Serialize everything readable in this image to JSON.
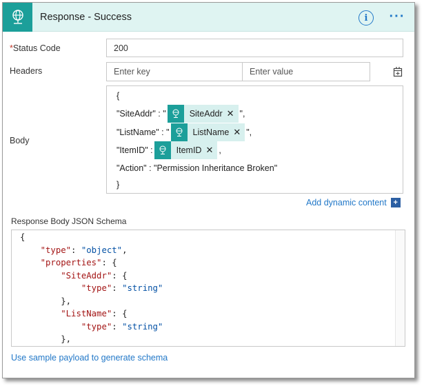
{
  "header": {
    "title": "Response - Success",
    "info_label": "i",
    "more_label": "···"
  },
  "form": {
    "status_code": {
      "required_mark": "*",
      "label": "Status Code",
      "value": "200"
    },
    "headers": {
      "label": "Headers",
      "key_placeholder": "Enter key",
      "value_placeholder": "Enter value"
    },
    "body": {
      "label": "Body",
      "open_brace": "{",
      "close_brace": "}",
      "lines": [
        {
          "prefix": "\"SiteAddr\" : \"",
          "token": "SiteAddr",
          "suffix": "\","
        },
        {
          "prefix": "\"ListName\" : \"",
          "token": "ListName",
          "suffix": "\","
        },
        {
          "prefix": "\"ItemID\" : ",
          "token": "ItemID",
          "suffix": ","
        }
      ],
      "action_line": "\"Action\" : \"Permission Inheritance Broken\""
    },
    "add_dynamic": "Add dynamic content",
    "schema": {
      "label": "Response Body JSON Schema",
      "lines": [
        {
          "indent": "",
          "parts": [
            {
              "t": "p",
              "v": "{"
            }
          ]
        },
        {
          "indent": "    ",
          "parts": [
            {
              "t": "k",
              "v": "\"type\""
            },
            {
              "t": "p",
              "v": ": "
            },
            {
              "t": "s",
              "v": "\"object\""
            },
            {
              "t": "p",
              "v": ","
            }
          ]
        },
        {
          "indent": "    ",
          "parts": [
            {
              "t": "k",
              "v": "\"properties\""
            },
            {
              "t": "p",
              "v": ": {"
            }
          ]
        },
        {
          "indent": "        ",
          "parts": [
            {
              "t": "k",
              "v": "\"SiteAddr\""
            },
            {
              "t": "p",
              "v": ": {"
            }
          ]
        },
        {
          "indent": "            ",
          "parts": [
            {
              "t": "k",
              "v": "\"type\""
            },
            {
              "t": "p",
              "v": ": "
            },
            {
              "t": "s",
              "v": "\"string\""
            }
          ]
        },
        {
          "indent": "        ",
          "parts": [
            {
              "t": "p",
              "v": "},"
            }
          ]
        },
        {
          "indent": "        ",
          "parts": [
            {
              "t": "k",
              "v": "\"ListName\""
            },
            {
              "t": "p",
              "v": ": {"
            }
          ]
        },
        {
          "indent": "            ",
          "parts": [
            {
              "t": "k",
              "v": "\"type\""
            },
            {
              "t": "p",
              "v": ": "
            },
            {
              "t": "s",
              "v": "\"string\""
            }
          ]
        },
        {
          "indent": "        ",
          "parts": [
            {
              "t": "p",
              "v": "},"
            }
          ]
        }
      ]
    },
    "sample_link": "Use sample payload to generate schema"
  },
  "colors": {
    "accent": "#1c9f9a",
    "header_bg": "#dff4f2",
    "link": "#2278c8",
    "token_bg": "#d7f0ee"
  }
}
